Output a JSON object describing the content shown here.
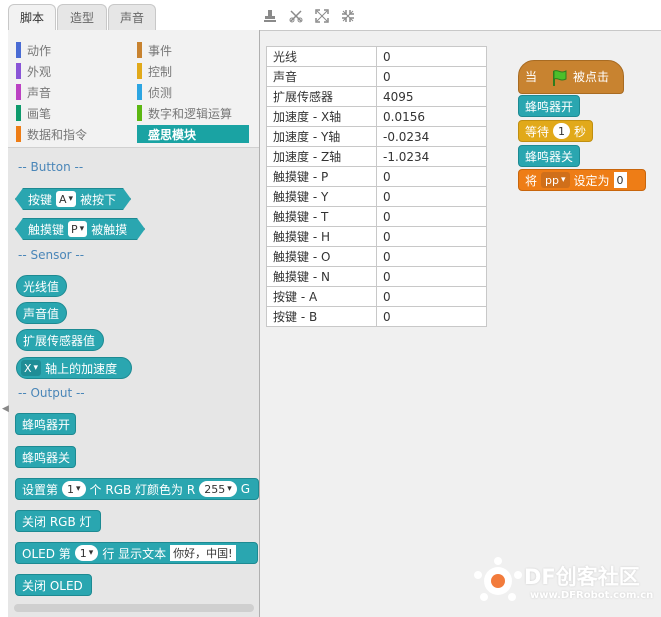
{
  "tabs": [
    {
      "label": "脚本"
    },
    {
      "label": "造型"
    },
    {
      "label": "声音"
    }
  ],
  "toolbar": {
    "icons": [
      "stamp-icon",
      "scissors-icon",
      "grow-icon",
      "shrink-icon"
    ]
  },
  "categories": [
    {
      "label": "动作",
      "color": "#4a6cd4"
    },
    {
      "label": "事件",
      "color": "#c88330"
    },
    {
      "label": "外观",
      "color": "#8a55d7"
    },
    {
      "label": "控制",
      "color": "#e1a91a"
    },
    {
      "label": "声音",
      "color": "#bb42c3"
    },
    {
      "label": "侦测",
      "color": "#2ca5e2"
    },
    {
      "label": "画笔",
      "color": "#0e9a6c"
    },
    {
      "label": "数字和逻辑运算",
      "color": "#5cb712"
    },
    {
      "label": "数据和指令",
      "color": "#ee7d16"
    },
    {
      "label": "盛思模块",
      "color": "#1aa3a3"
    }
  ],
  "palette": {
    "sections": {
      "button": "-- Button --",
      "sensor": "-- Sensor --",
      "output": "-- Output --"
    },
    "button_pressed": {
      "pre": "按键",
      "dd": "A",
      "post": "被按下"
    },
    "touch_pressed": {
      "pre": "触摸键",
      "dd": "P",
      "post": "被触摸"
    },
    "light_value": "光线值",
    "sound_value": "声音值",
    "ext_sensor_value": "扩展传感器值",
    "accel": {
      "dd": "X",
      "post": "轴上的加速度"
    },
    "buzzer_on": "蜂鸣器开",
    "buzzer_off": "蜂鸣器关",
    "set_rgb": {
      "pre": "设置第",
      "num": "1",
      "mid": "个 RGB 灯颜色为 R",
      "r": "255",
      "post": "G"
    },
    "rgb_off": "关闭 RGB 灯",
    "oled_text": {
      "pre": "OLED 第",
      "num": "1",
      "mid": "行 显示文本",
      "text": "你好，中国!"
    },
    "oled_off": "关闭 OLED"
  },
  "sensor_table": [
    {
      "key": "光线",
      "value": "0"
    },
    {
      "key": "声音",
      "value": "0"
    },
    {
      "key": "扩展传感器",
      "value": "4095"
    },
    {
      "key": "加速度 - X轴",
      "value": "0.0156"
    },
    {
      "key": "加速度 - Y轴",
      "value": "-0.0234"
    },
    {
      "key": "加速度 - Z轴",
      "value": "-1.0234"
    },
    {
      "key": "触摸键 - P",
      "value": "0"
    },
    {
      "key": "触摸键 - Y",
      "value": "0"
    },
    {
      "key": "触摸键 - T",
      "value": "0"
    },
    {
      "key": "触摸键 - H",
      "value": "0"
    },
    {
      "key": "触摸键 - O",
      "value": "0"
    },
    {
      "key": "触摸键 - N",
      "value": "0"
    },
    {
      "key": "按键 - A",
      "value": "0"
    },
    {
      "key": "按键 - B",
      "value": "0"
    }
  ],
  "script": {
    "hat": {
      "pre": "当",
      "post": "被点击"
    },
    "buzzer_on": "蜂鸣器开",
    "wait": {
      "pre": "等待",
      "num": "1",
      "post": "秒"
    },
    "buzzer_off": "蜂鸣器关",
    "set_var": {
      "pre": "将",
      "var": "pp",
      "mid": "设定为",
      "val": "0"
    }
  },
  "watermark": {
    "brand": "DF创客社区",
    "url": "www.DFRobot.com.cn"
  }
}
